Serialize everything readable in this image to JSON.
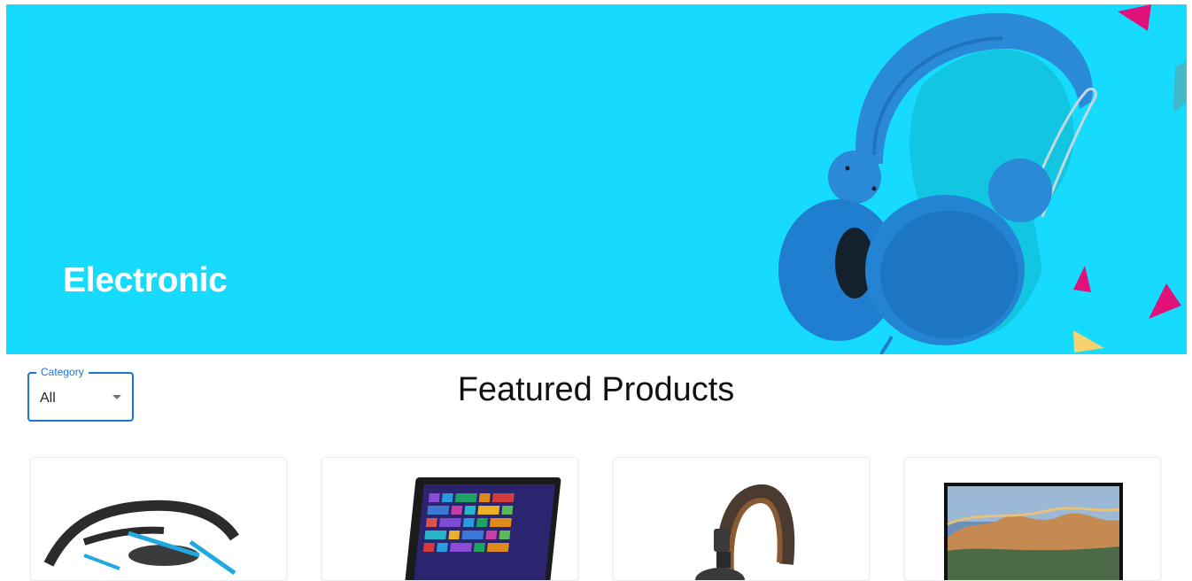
{
  "hero": {
    "title": "Electronic",
    "background_color": "#16dbfe",
    "image": "blue-headphones"
  },
  "filter": {
    "label": "Category",
    "value": "All",
    "icon": "caret-down-icon",
    "accent_color": "#1976d2"
  },
  "section": {
    "title": "Featured Products"
  },
  "products": [
    {
      "image": "quadcopter-drone"
    },
    {
      "image": "windows-laptop"
    },
    {
      "image": "brown-headphones"
    },
    {
      "image": "flat-screen-tv"
    }
  ]
}
